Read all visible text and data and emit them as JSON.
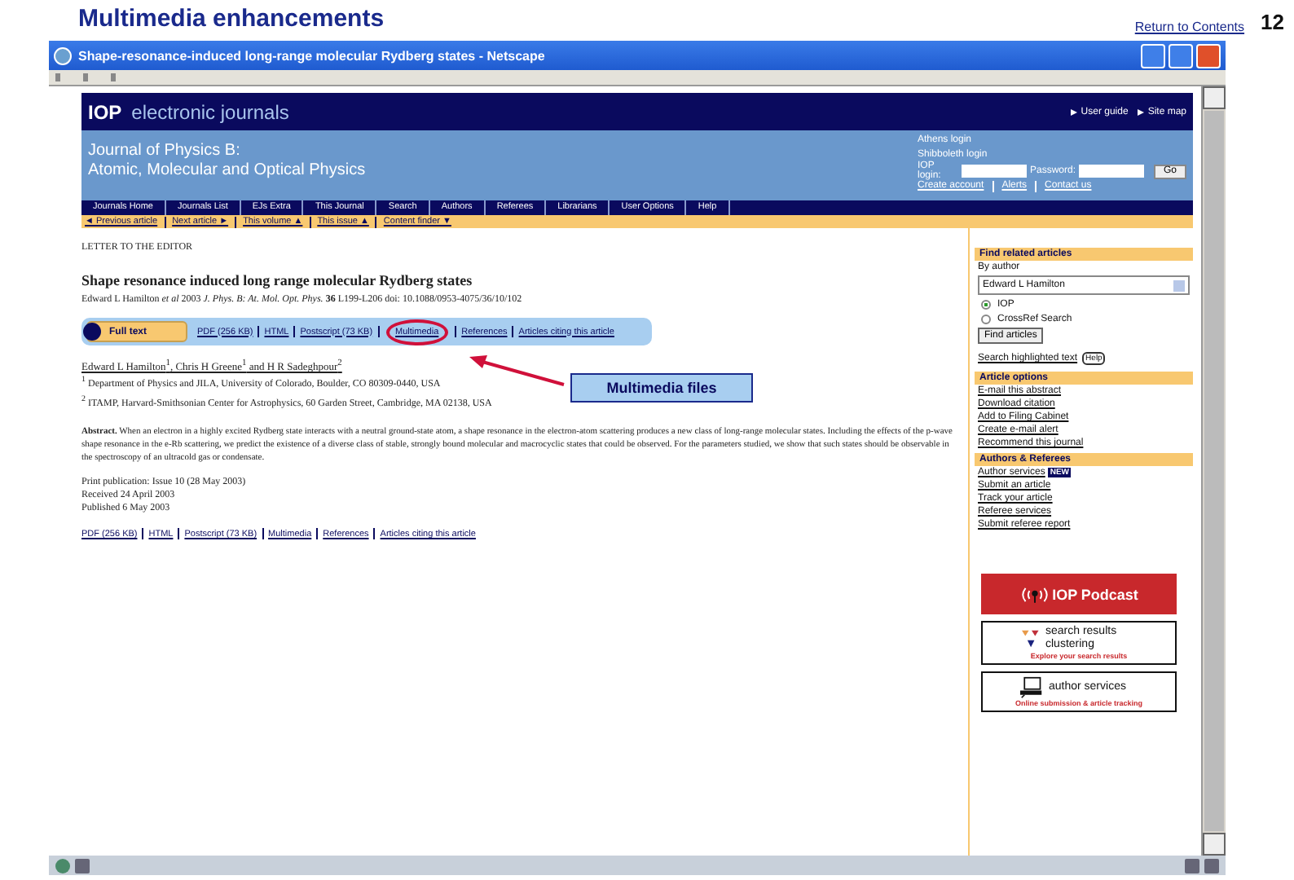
{
  "slide": {
    "title": "Multimedia enhancements",
    "return_link": "Return to Contents",
    "page_number": "12"
  },
  "window": {
    "title": "Shape-resonance-induced long-range molecular Rydberg states - Netscape"
  },
  "site": {
    "brand": "IOP",
    "brand_text": "electronic journals",
    "top_links": [
      "User guide",
      "Site map"
    ],
    "journal_title": "Journal of Physics B:",
    "journal_subtitle": "Atomic, Molecular and Optical Physics",
    "login_links": [
      "Athens login",
      "Shibboleth login"
    ],
    "login_label": "IOP login:",
    "password_label": "Password:",
    "go_button": "Go",
    "account_links": [
      "Create account",
      "Alerts",
      "Contact us"
    ]
  },
  "nav": [
    "Journals Home",
    "Journals List",
    "EJs Extra",
    "This Journal",
    "Search",
    "Authors",
    "Referees",
    "Librarians",
    "User Options",
    "Help"
  ],
  "article_nav": [
    "◄ Previous article",
    "Next article ►",
    "This volume ▲",
    "This issue ▲",
    "Content finder ▼"
  ],
  "article": {
    "section": "LETTER TO THE EDITOR",
    "title": "Shape resonance induced long range molecular Rydberg states",
    "citation": "Edward L Hamilton *et al* 2003 *J. Phys. B: At. Mol. Opt. Phys.* **36** L199-L206   doi: 10.1088/0953-4075/36/10/102",
    "full_text_button": "Full text",
    "formats": [
      {
        "text": "PDF (256 KB)",
        "highlighted": false
      },
      {
        "text": "HTML",
        "highlighted": false
      },
      {
        "text": "Postscript (73 KB)",
        "highlighted": false
      },
      {
        "text": "Multimedia",
        "highlighted": true
      },
      {
        "text": "References",
        "highlighted": false
      },
      {
        "text": "Articles citing this article",
        "highlighted": false
      }
    ],
    "authors": "Edward L Hamilton$^{1}$, Chris H Greene$^{1}$ and H R Sadeghpour$^{2}$",
    "affiliations": [
      "$^{1}$ Department of Physics and JILA, University of Colorado, Boulder, CO 80309-0440, USA",
      "$^{2}$ ITAMP, Harvard-Smithsonian Center for Astrophysics, 60 Garden Street, Cambridge, MA 02138, USA"
    ],
    "abstract": "**Abstract.** When an electron in a highly excited Rydberg state interacts with a neutral ground-state atom, a shape resonance in the electron-atom scattering produces a new class of long-range molecular states. Including the effects of the p-wave shape resonance in the e-Rb scattering, we predict the existence of a diverse class of stable, strongly bound molecular and macrocyclic states that could be observed. For the parameters studied, we show that such states should be observable in the spectroscopy of an ultracold gas or condensate.",
    "dates": [
      "Print publication: Issue 10 (28 May 2003)",
      "Received 24 April 2003",
      "Published 6 May 2003"
    ],
    "bottom_formats": [
      "PDF (256 KB)",
      "HTML",
      "Postscript (73 KB)",
      "Multimedia",
      "References",
      "Articles citing this article"
    ]
  },
  "callout": {
    "text": "Multimedia files"
  },
  "sidebar": {
    "find_heading": "Find related articles",
    "by_author": "By author",
    "author_select": "Edward L Hamilton",
    "radios": [
      {
        "label": "IOP",
        "selected": true
      },
      {
        "label": "CrossRef Search",
        "selected": false
      }
    ],
    "find_button": "Find articles",
    "highlight_link": "Search highlighted text",
    "help": "Help",
    "options_heading": "Article options",
    "options": [
      "E-mail this abstract",
      "Download citation",
      "Add to Filing Cabinet",
      "Create e-mail alert",
      "Recommend this journal"
    ],
    "authors_heading": "Authors & Referees",
    "author_links": [
      {
        "text": "Author services",
        "badge": "NEW"
      },
      {
        "text": "Submit an article"
      },
      {
        "text": "Track your article"
      },
      {
        "text": "Referee services"
      },
      {
        "text": "Submit referee report"
      }
    ],
    "podcast": "IOP Podcast",
    "clustering_title": "search results clustering",
    "clustering_sub": "Explore your search results",
    "services_title": "author services",
    "services_sub": "Online submission & article tracking"
  }
}
